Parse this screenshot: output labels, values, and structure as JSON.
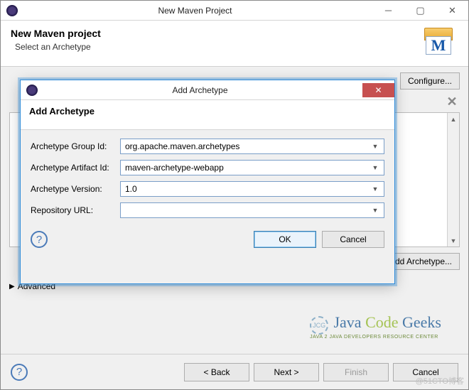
{
  "parent": {
    "title": "New Maven Project",
    "header_title": "New Maven project",
    "header_subtitle": "Select an Archetype",
    "configure_btn": "Configure...",
    "add_archetype_btn": "Add Archetype...",
    "advanced_label": "Advanced",
    "back_btn": "< Back",
    "next_btn": "Next >",
    "finish_btn": "Finish",
    "cancel_btn": "Cancel"
  },
  "modal": {
    "title": "Add Archetype",
    "header": "Add Archetype",
    "fields": {
      "group_id": {
        "label": "Archetype Group Id:",
        "value": "org.apache.maven.archetypes"
      },
      "artifact_id": {
        "label": "Archetype Artifact Id:",
        "value": "maven-archetype-webapp"
      },
      "version": {
        "label": "Archetype Version:",
        "value": "1.0"
      },
      "repo_url": {
        "label": "Repository URL:",
        "value": ""
      }
    },
    "ok_btn": "OK",
    "cancel_btn": "Cancel"
  },
  "watermark": {
    "brand_java": "Java",
    "brand_code": "Code",
    "brand_geeks": "Geeks",
    "tagline": "Java 2 Java Developers Resource Center",
    "corner": "@51CTO博客"
  }
}
